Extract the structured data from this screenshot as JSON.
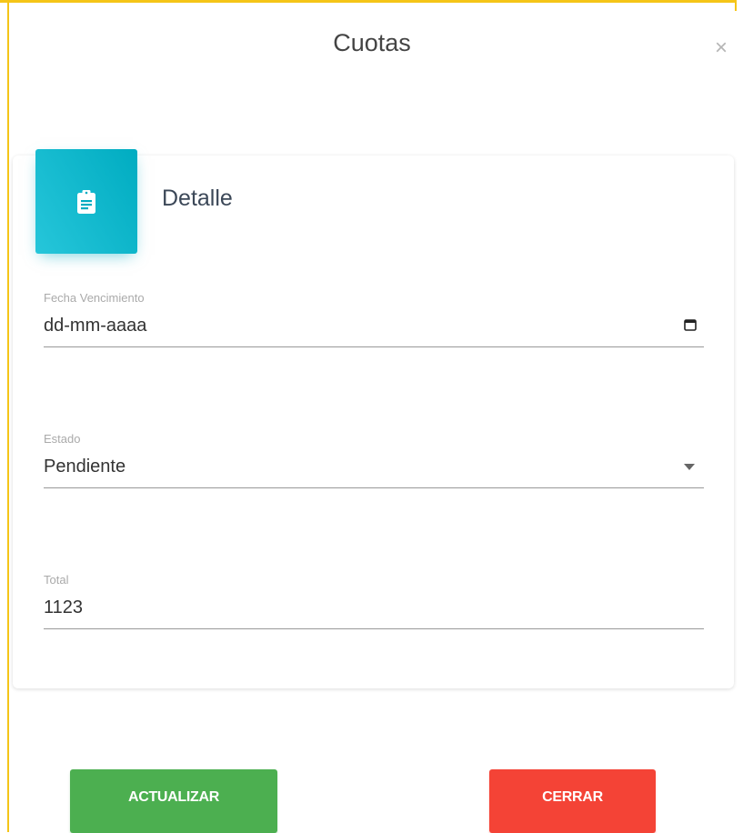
{
  "modal": {
    "title": "Cuotas",
    "close_symbol": "×"
  },
  "card": {
    "icon": "clipboard-icon",
    "title": "Detalle",
    "accent_color": "#00acc1"
  },
  "form": {
    "fecha_vencimiento": {
      "label": "Fecha Vencimiento",
      "placeholder": "dd-mm-aaaa",
      "icon": "calendar-icon"
    },
    "estado": {
      "label": "Estado",
      "selected": "Pendiente",
      "icon": "caret-down-icon"
    },
    "total": {
      "label": "Total",
      "value": "1123"
    }
  },
  "actions": {
    "update_label": "ACTUALIZAR",
    "update_color": "#4caf50",
    "close_label": "CERRAR",
    "close_color": "#f44336"
  }
}
